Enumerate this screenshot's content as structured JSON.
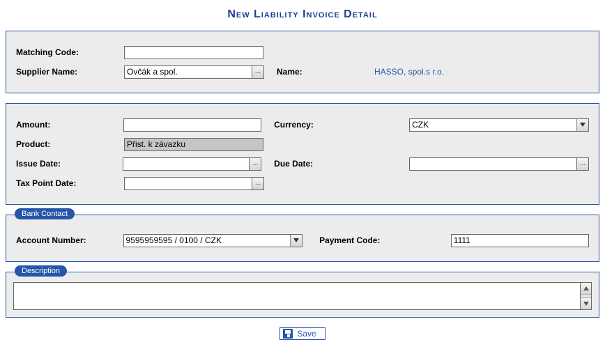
{
  "title": "New Liability Invoice Detail",
  "section1": {
    "matching_code_label": "Matching Code:",
    "matching_code_value": "",
    "supplier_name_label": "Supplier Name:",
    "supplier_name_value": "Ovčák a spol.",
    "name_label": "Name:",
    "name_link": "HASSO, spol.s r.o."
  },
  "section2": {
    "amount_label": "Amount:",
    "amount_value": "",
    "currency_label": "Currency:",
    "currency_value": "CZK",
    "product_label": "Product:",
    "product_value": "Přist. k závazku",
    "issue_date_label": "Issue Date:",
    "issue_date_value": "",
    "due_date_label": "Due Date:",
    "due_date_value": "",
    "tax_point_date_label": "Tax Point Date:",
    "tax_point_date_value": ""
  },
  "bank": {
    "legend": "Bank Contact",
    "account_number_label": "Account Number:",
    "account_number_value": "9595959595 / 0100 / CZK",
    "payment_code_label": "Payment Code:",
    "payment_code_value": "1111"
  },
  "description": {
    "legend": "Description",
    "value": ""
  },
  "buttons": {
    "picker": "...",
    "save": "Save"
  }
}
